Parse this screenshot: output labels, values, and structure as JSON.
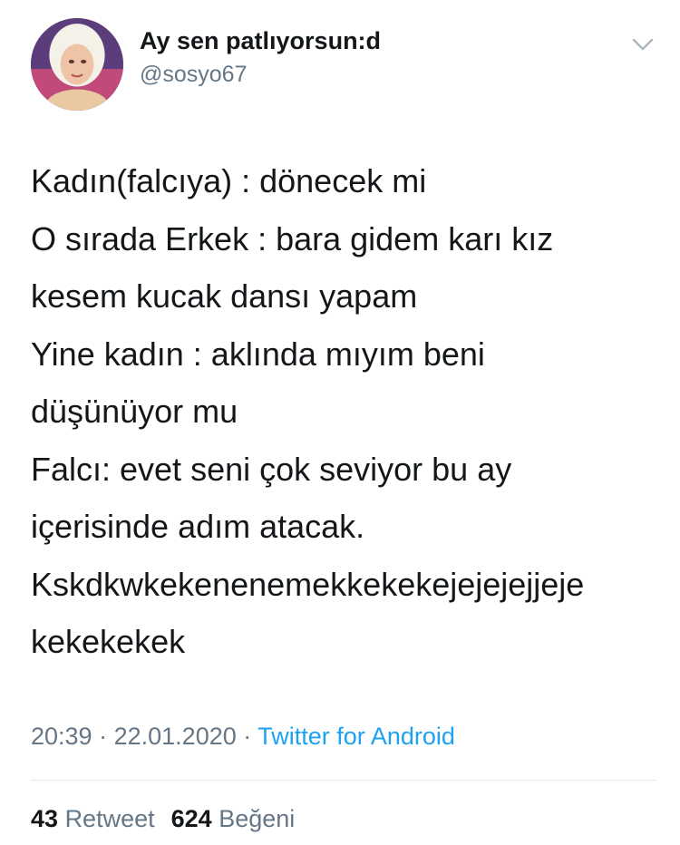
{
  "tweet": {
    "author": {
      "display_name": "Ay sen patlıyorsun:d",
      "handle": "@sosyo67"
    },
    "text_lines": [
      "Kadın(falcıya) : dönecek mi",
      "O sırada Erkek : bara gidem karı kız",
      "kesem kucak dansı yapam",
      "Yine kadın : aklında mıyım beni",
      "düşünüyor mu",
      "Falcı: evet seni çok seviyor bu ay",
      "içerisinde adım atacak.",
      "Kskdkwkekenenemekkekekejejejejjeje",
      "kekekekek"
    ],
    "time": "20:39",
    "date": "22.01.2020",
    "separator": "·",
    "source": "Twitter for Android",
    "retweets": {
      "count": "43",
      "label": "Retweet"
    },
    "likes": {
      "count": "624",
      "label": "Beğeni"
    }
  },
  "icons": {
    "menu": "chevron-down-icon"
  },
  "colors": {
    "text": "#14171a",
    "secondary": "#657786",
    "link": "#1da1f2",
    "divider": "#e1e8ed"
  }
}
